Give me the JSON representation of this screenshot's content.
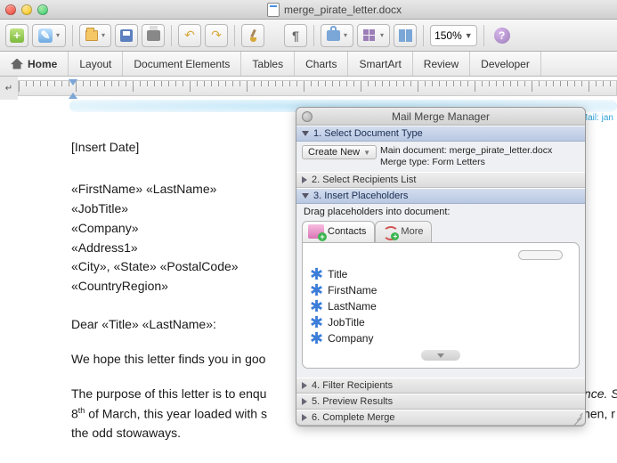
{
  "window": {
    "title": "merge_pirate_letter.docx"
  },
  "toolbar": {
    "zoom": "150%"
  },
  "ribbon": {
    "tabs": [
      "Home",
      "Layout",
      "Document Elements",
      "Tables",
      "Charts",
      "SmartArt",
      "Review",
      "Developer"
    ]
  },
  "header_hint": "E-Mail: jan",
  "document": {
    "insert_date": "[Insert Date]",
    "recipient_lines": [
      "«FirstName» «LastName»",
      "«JobTitle»",
      "«Company»",
      "«Address1»",
      "«City», «State» «PostalCode»",
      "«CountryRegion»"
    ],
    "salutation": "Dear «Title» «LastName»:",
    "body1": "We hope this letter finds you in goo",
    "body2a": "The purpose of this letter is to enqu",
    "body2b": "alence. S",
    "body3a": "8",
    "body3sup": "th",
    "body3b": " of March, this year loaded with s",
    "body3c": "ed men, r",
    "body4": "the odd stowaways."
  },
  "panel": {
    "title": "Mail Merge Manager",
    "sections": {
      "s1": "1. Select Document Type",
      "s2": "2. Select Recipients List",
      "s3": "3. Insert Placeholders",
      "s4": "4. Filter Recipients",
      "s5": "5. Preview Results",
      "s6": "6. Complete Merge"
    },
    "create_new": "Create New",
    "main_doc": "Main document: merge_pirate_letter.docx",
    "merge_type": "Merge type: Form Letters",
    "drag_hint": "Drag placeholders into document:",
    "tabs": {
      "contacts": "Contacts",
      "more": "More"
    },
    "fields": [
      "Title",
      "FirstName",
      "LastName",
      "JobTitle",
      "Company"
    ]
  }
}
